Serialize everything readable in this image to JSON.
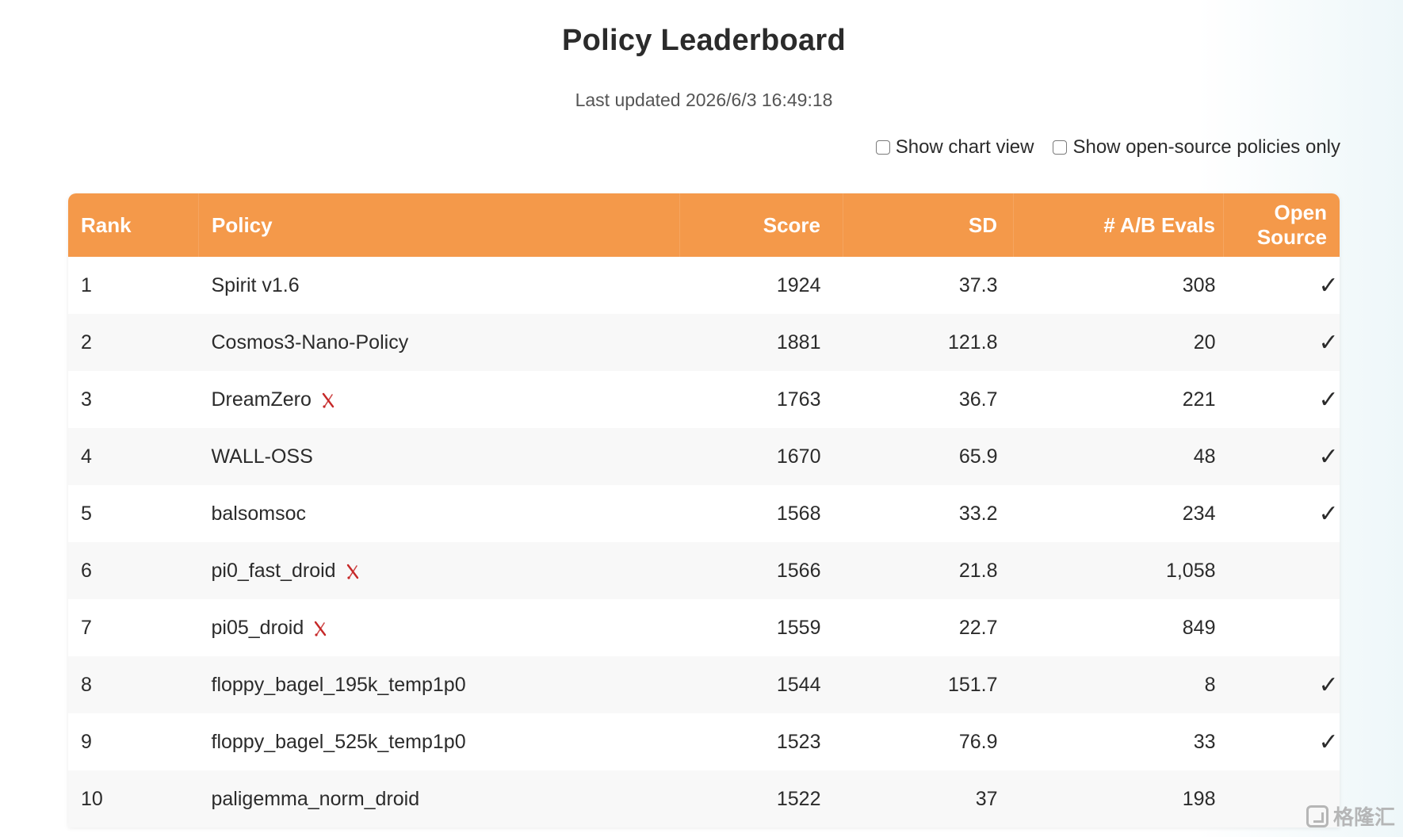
{
  "page": {
    "title": "Policy Leaderboard",
    "last_updated": "Last updated 2026/6/3 16:49:18"
  },
  "controls": {
    "chart_view_label": "Show chart view",
    "chart_view_checked": false,
    "open_source_label": "Show open-source policies only",
    "open_source_checked": false
  },
  "table": {
    "headers": {
      "rank": "Rank",
      "policy": "Policy",
      "score": "Score",
      "sd": "SD",
      "evals": "# A/B Evals",
      "open_source": "Open Source"
    },
    "check_symbol": "✓",
    "rows": [
      {
        "rank": "1",
        "policy": "Spirit v1.6",
        "score": "1924",
        "sd": "37.3",
        "evals": "308",
        "open_source": true,
        "flag": false
      },
      {
        "rank": "2",
        "policy": "Cosmos3-Nano-Policy",
        "score": "1881",
        "sd": "121.8",
        "evals": "20",
        "open_source": true,
        "flag": false
      },
      {
        "rank": "3",
        "policy": "DreamZero",
        "score": "1763",
        "sd": "36.7",
        "evals": "221",
        "open_source": true,
        "flag": true
      },
      {
        "rank": "4",
        "policy": "WALL-OSS",
        "score": "1670",
        "sd": "65.9",
        "evals": "48",
        "open_source": true,
        "flag": false
      },
      {
        "rank": "5",
        "policy": "balsomsoc",
        "score": "1568",
        "sd": "33.2",
        "evals": "234",
        "open_source": true,
        "flag": false
      },
      {
        "rank": "6",
        "policy": "pi0_fast_droid",
        "score": "1566",
        "sd": "21.8",
        "evals": "1,058",
        "open_source": false,
        "flag": true
      },
      {
        "rank": "7",
        "policy": "pi05_droid",
        "score": "1559",
        "sd": "22.7",
        "evals": "849",
        "open_source": false,
        "flag": true
      },
      {
        "rank": "8",
        "policy": "floppy_bagel_195k_temp1p0",
        "score": "1544",
        "sd": "151.7",
        "evals": "8",
        "open_source": true,
        "flag": false
      },
      {
        "rank": "9",
        "policy": "floppy_bagel_525k_temp1p0",
        "score": "1523",
        "sd": "76.9",
        "evals": "33",
        "open_source": true,
        "flag": false
      },
      {
        "rank": "10",
        "policy": "paligemma_norm_droid",
        "score": "1522",
        "sd": "37",
        "evals": "198",
        "open_source": false,
        "flag": false
      }
    ]
  },
  "icons": {
    "flag_icon": "x-mark-icon",
    "check_icon": "checkmark-icon"
  },
  "colors": {
    "header_bg": "#f4994a",
    "header_text": "#ffffff",
    "flag_red": "#c62828"
  },
  "watermark": {
    "text": "格隆汇"
  }
}
